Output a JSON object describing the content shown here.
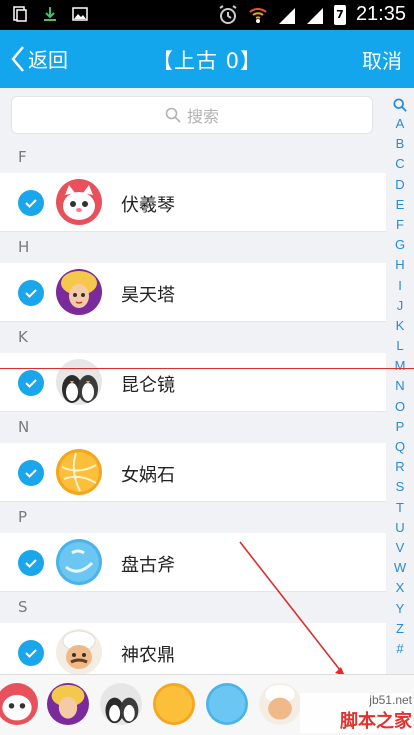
{
  "status_bar": {
    "time": "21:35",
    "battery": "7"
  },
  "nav": {
    "back_label": "返回",
    "title": "【上古 0】",
    "cancel_label": "取消"
  },
  "search": {
    "placeholder": "搜索"
  },
  "sections": [
    {
      "letter": "F",
      "items": [
        {
          "name": "伏羲琴",
          "avatar": "pink-cat-avatar"
        }
      ]
    },
    {
      "letter": "H",
      "items": [
        {
          "name": "昊天塔",
          "avatar": "game-girl-avatar"
        }
      ]
    },
    {
      "letter": "K",
      "items": [
        {
          "name": "昆仑镜",
          "avatar": "penguin-avatar"
        }
      ]
    },
    {
      "letter": "N",
      "items": [
        {
          "name": "女娲石",
          "avatar": "orange-ball-avatar"
        }
      ]
    },
    {
      "letter": "P",
      "items": [
        {
          "name": "盘古斧",
          "avatar": "blue-swirl-avatar"
        }
      ]
    },
    {
      "letter": "S",
      "items": [
        {
          "name": "神农鼎",
          "avatar": "chef-avatar"
        }
      ]
    }
  ],
  "index_letters": [
    "A",
    "B",
    "C",
    "D",
    "E",
    "F",
    "G",
    "H",
    "I",
    "J",
    "K",
    "L",
    "M",
    "N",
    "O",
    "P",
    "Q",
    "R",
    "S",
    "T",
    "U",
    "V",
    "W",
    "X",
    "Y",
    "Z",
    "#"
  ],
  "watermark": {
    "url": "jb51.net",
    "text": "脚本之家"
  },
  "colors": {
    "primary": "#13a6ed",
    "check": "#1aa6ea",
    "annotation": "#d9302c"
  }
}
